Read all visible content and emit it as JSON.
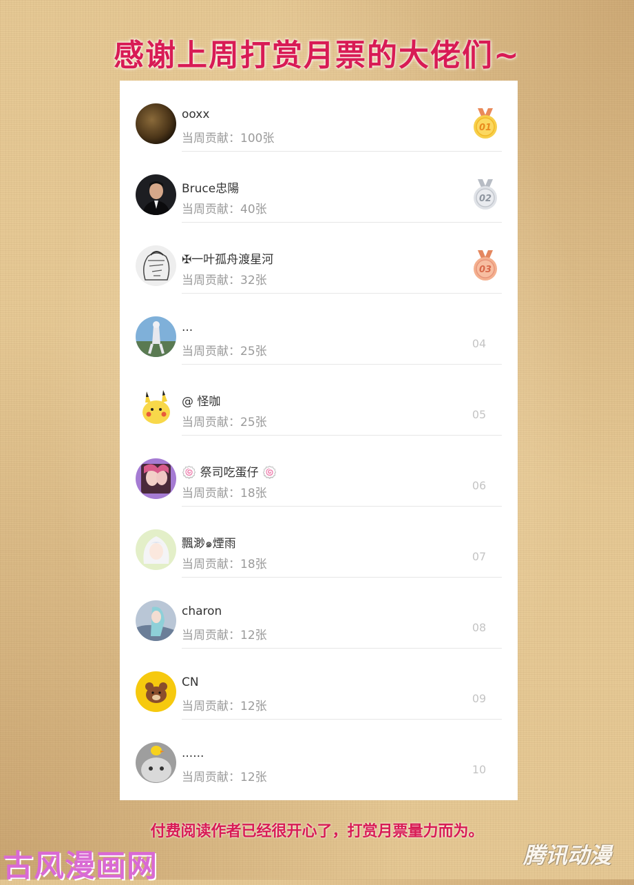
{
  "headline": "感谢上周打赏月票的大佬们~",
  "contribution_prefix": "当周贡献：",
  "supporters": [
    {
      "name": "ooxx",
      "contribution": "当周贡献：100张",
      "rank": "01",
      "medal": "gold"
    },
    {
      "name": "Bruce忠陽",
      "contribution": "当周贡献：40张",
      "rank": "02",
      "medal": "silver"
    },
    {
      "name": "✠一叶孤舟渡星河",
      "contribution": "当周贡献：32张",
      "rank": "03",
      "medal": "bronze"
    },
    {
      "name": "...",
      "contribution": "当周贡献：25张",
      "rank": "04"
    },
    {
      "name": "@ 怪咖",
      "contribution": "当周贡献：25张",
      "rank": "05"
    },
    {
      "name": "🍥 祭司吃蛋仔 🍥",
      "contribution": "当周贡献：18张",
      "rank": "06"
    },
    {
      "name": "飄渺๑煙雨",
      "contribution": "当周贡献：18张",
      "rank": "07"
    },
    {
      "name": "charon",
      "contribution": "当周贡献：12张",
      "rank": "08"
    },
    {
      "name": "CN",
      "contribution": "当周贡献：12张",
      "rank": "09"
    },
    {
      "name": "......",
      "contribution": "当周贡献：12张",
      "rank": "10"
    }
  ],
  "footer_note": "付费阅读作者已经很开心了，打赏月票量力而为。",
  "watermark_left": "古风漫画网",
  "watermark_right": "腾讯动漫",
  "colors": {
    "accent": "#d81b55",
    "gold": "#f5c23a",
    "silver": "#c9ccd2",
    "bronze": "#f0a07c",
    "rank_text": "#c4c4c4"
  }
}
